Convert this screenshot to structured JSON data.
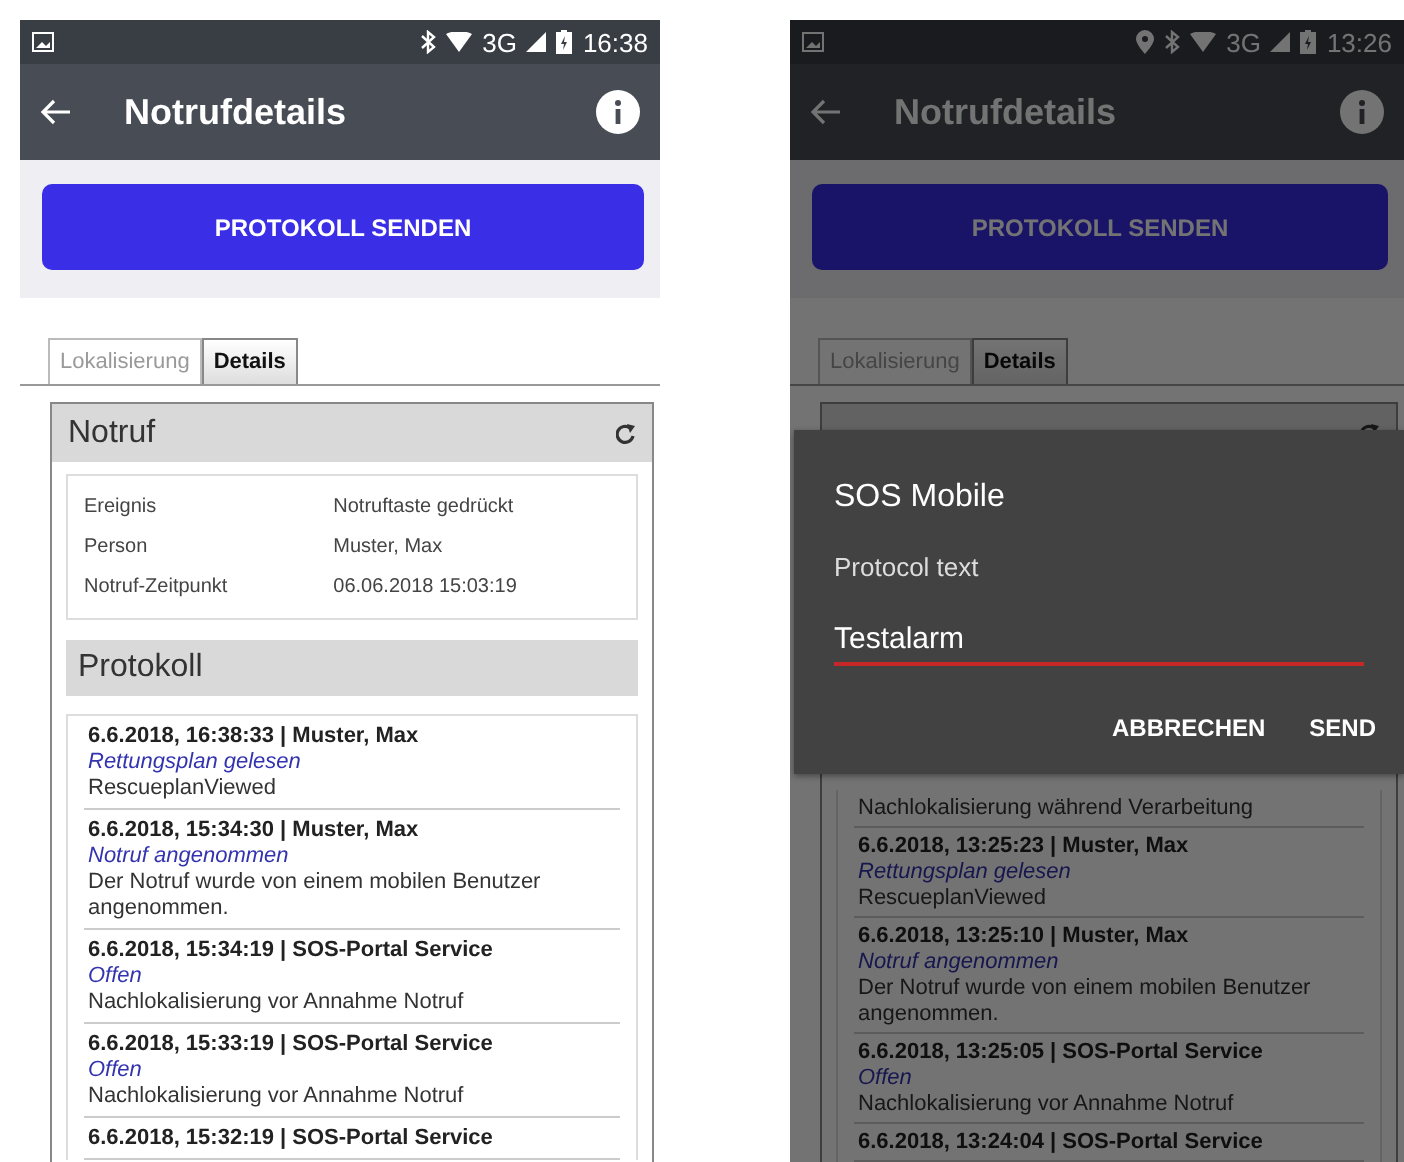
{
  "screens": [
    {
      "status_bar": {
        "location_icon": false,
        "network": "3G",
        "time": "16:38"
      },
      "app_bar": {
        "title": "Notrufdetails"
      },
      "send_button": "PROTOKOLL SENDEN",
      "tabs": [
        {
          "label": "Lokalisierung",
          "selected": false
        },
        {
          "label": "Details",
          "selected": true
        }
      ],
      "notruf": {
        "heading": "Notruf",
        "fields": [
          {
            "label": "Ereignis",
            "value": "Notruftaste gedrückt"
          },
          {
            "label": "Person",
            "value": "Muster, Max"
          },
          {
            "label": "Notruf-Zeitpunkt",
            "value": "06.06.2018 15:03:19"
          }
        ]
      },
      "protokoll": {
        "heading": "Protokoll",
        "entries": [
          {
            "header": "6.6.2018, 16:38:33 | Muster, Max",
            "status": "Rettungsplan gelesen",
            "text": "RescueplanViewed"
          },
          {
            "header": "6.6.2018, 15:34:30 | Muster, Max",
            "status": "Notruf angenommen",
            "text": "Der Notruf wurde von einem mobilen Benutzer angenommen."
          },
          {
            "header": "6.6.2018, 15:34:19 | SOS-Portal Service",
            "status": "Offen",
            "text": "Nachlokalisierung vor Annahme Notruf"
          },
          {
            "header": "6.6.2018, 15:33:19 | SOS-Portal Service",
            "status": "Offen",
            "text": "Nachlokalisierung vor Annahme Notruf"
          },
          {
            "header": "6.6.2018, 15:32:19 | SOS-Portal Service"
          }
        ]
      }
    },
    {
      "status_bar": {
        "location_icon": true,
        "network": "3G",
        "time": "13:26"
      },
      "app_bar": {
        "title": "Notrufdetails"
      },
      "send_button": "PROTOKOLL SENDEN",
      "tabs": [
        {
          "label": "Lokalisierung",
          "selected": false
        },
        {
          "label": "Details",
          "selected": true
        }
      ],
      "protokoll": {
        "entries": [
          {
            "text": "Nachlokalisierung während Verarbeitung"
          },
          {
            "header": "6.6.2018, 13:25:23 | Muster, Max",
            "status": "Rettungsplan gelesen",
            "text": "RescueplanViewed"
          },
          {
            "header": "6.6.2018, 13:25:10 | Muster, Max",
            "status": "Notruf angenommen",
            "text": "Der Notruf wurde von einem mobilen Benutzer angenommen."
          },
          {
            "header": "6.6.2018, 13:25:05 | SOS-Portal Service",
            "status": "Offen",
            "text": "Nachlokalisierung vor Annahme Notruf"
          },
          {
            "header": "6.6.2018, 13:24:04 | SOS-Portal Service"
          }
        ]
      },
      "dialog": {
        "title": "SOS Mobile",
        "label": "Protocol text",
        "value": "Testalarm",
        "buttons": [
          "ABBRECHEN",
          "SEND"
        ]
      }
    }
  ]
}
